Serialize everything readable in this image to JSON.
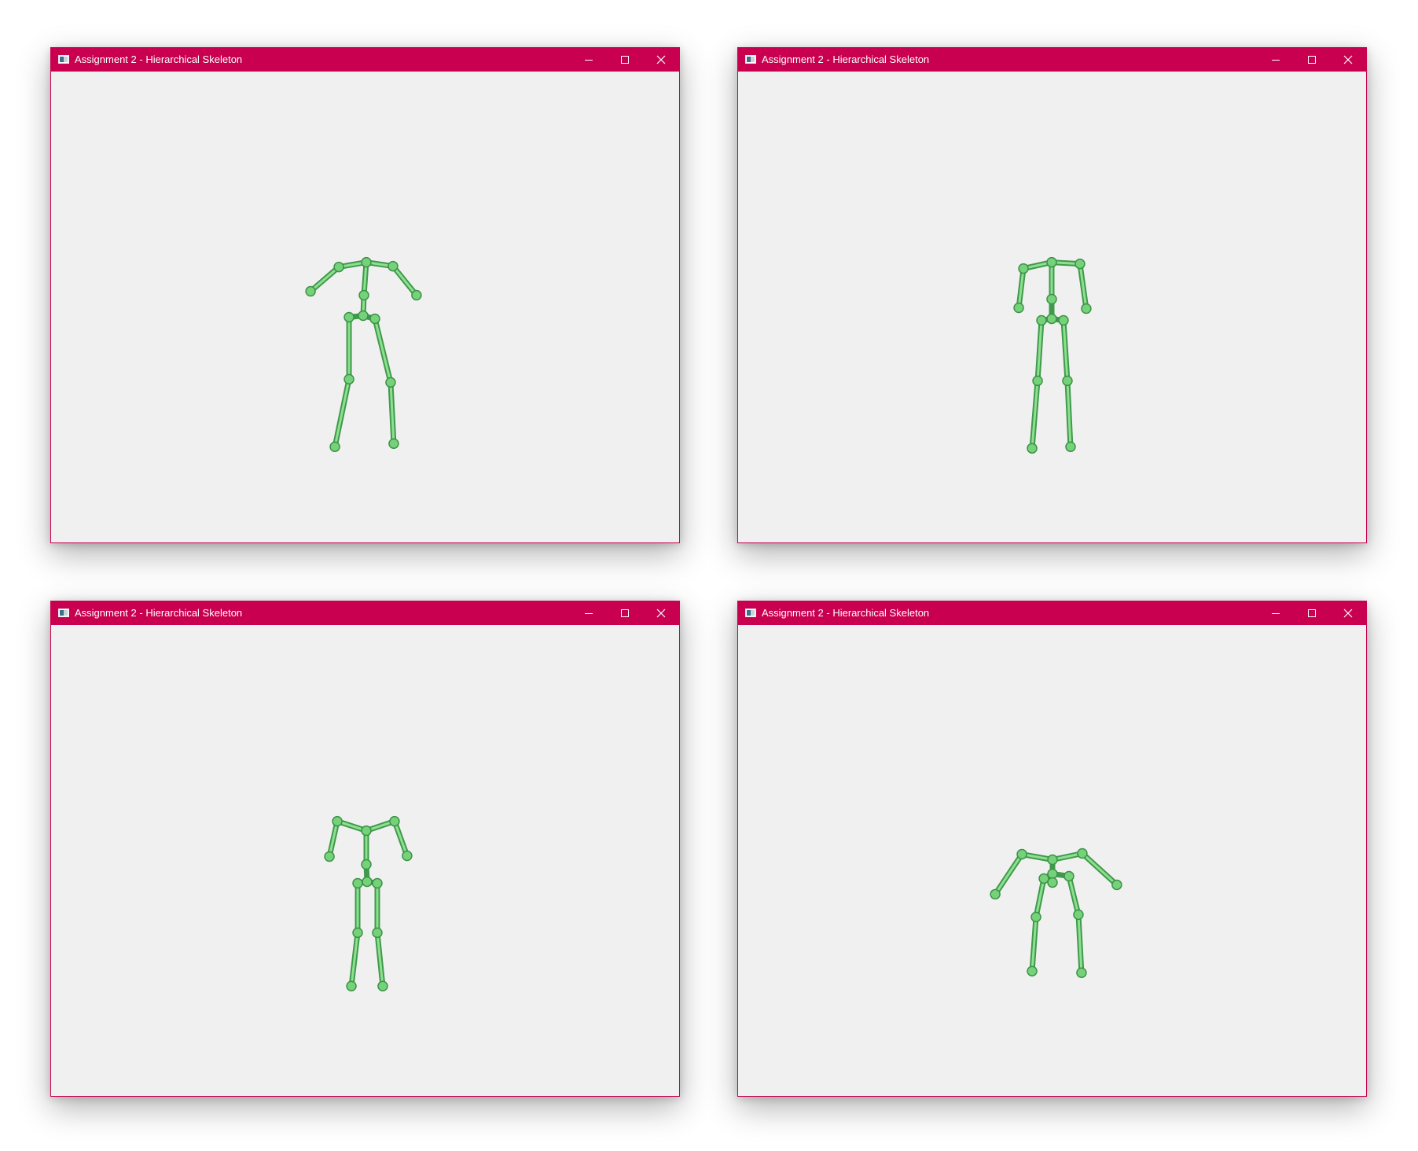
{
  "windows": [
    {
      "title": "Assignment 2 - Hierarchical Skeleton"
    },
    {
      "title": "Assignment 2 - Hierarchical Skeleton"
    },
    {
      "title": "Assignment 2 - Hierarchical Skeleton"
    },
    {
      "title": "Assignment 2 - Hierarchical Skeleton"
    }
  ],
  "controls": {
    "minimize_icon": "minimize-icon",
    "maximize_icon": "maximize-icon",
    "close_icon": "close-icon"
  },
  "colors": {
    "titlebar": "#c8004f",
    "viewport_background": "#f1f0f1",
    "bone": "#3f9a4b",
    "joint": "#76d27a"
  }
}
